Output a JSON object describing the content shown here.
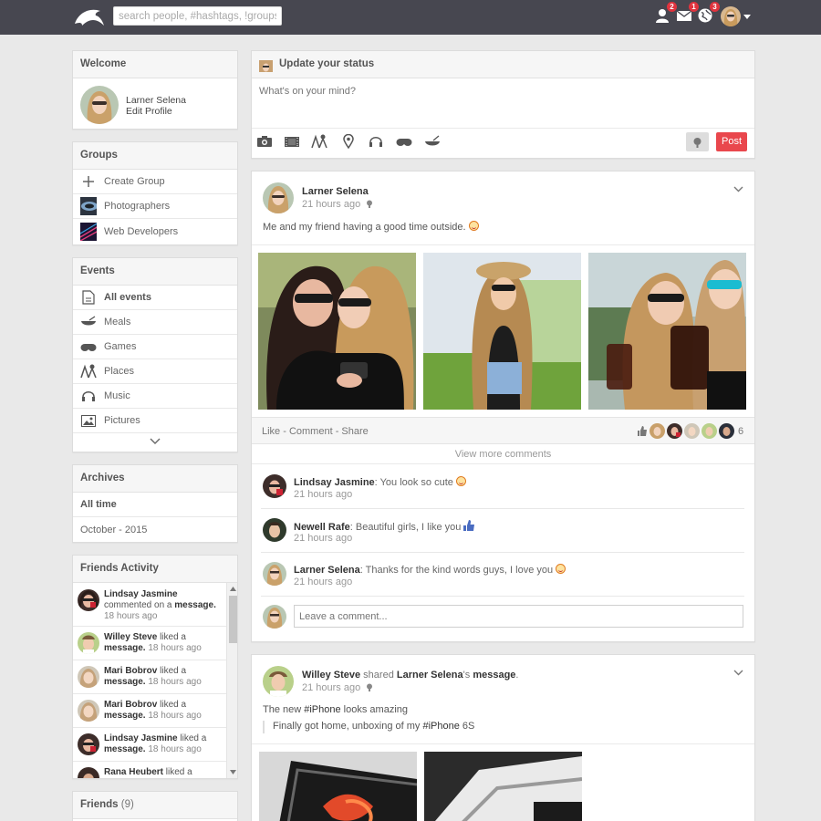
{
  "topbar": {
    "search_placeholder": "search people, #hashtags, !groups",
    "badges": {
      "friends": "2",
      "messages": "1",
      "notifications": "3"
    }
  },
  "welcome": {
    "title": "Welcome",
    "name": "Larner Selena",
    "edit": "Edit Profile"
  },
  "groups": {
    "title": "Groups",
    "items": [
      "Create Group",
      "Photographers",
      "Web Developers"
    ]
  },
  "events": {
    "title": "Events",
    "items": [
      "All events",
      "Meals",
      "Games",
      "Places",
      "Music",
      "Pictures"
    ]
  },
  "archives": {
    "title": "Archives",
    "items": [
      "All time",
      "October - 2015"
    ]
  },
  "friends_activity": {
    "title": "Friends Activity",
    "items": [
      {
        "name": "Lindsay Jasmine",
        "action": "commented on a",
        "object": "message.",
        "time": "18 hours ago"
      },
      {
        "name": "Willey Steve",
        "action": "liked a",
        "object": "message.",
        "time": "18 hours ago"
      },
      {
        "name": "Mari Bobrov",
        "action": "liked a",
        "object": "message.",
        "time": "18 hours ago"
      },
      {
        "name": "Mari Bobrov",
        "action": "liked a",
        "object": "message.",
        "time": "18 hours ago"
      },
      {
        "name": "Lindsay Jasmine",
        "action": "liked a",
        "object": "message.",
        "time": "18 hours ago"
      },
      {
        "name": "Rana Heubert",
        "action": "liked a",
        "object": "",
        "time": ""
      }
    ]
  },
  "friends": {
    "title": "Friends",
    "count": "(9)"
  },
  "status": {
    "title": "Update your status",
    "placeholder": "What's on your mind?",
    "post_label": "Post"
  },
  "post1": {
    "author": "Larner Selena",
    "time": "21 hours ago",
    "text": "Me and my friend having a good time outside.",
    "actions": "Like - Comment - Share",
    "likes_count": "6",
    "view_more": "View more comments",
    "comments": [
      {
        "name": "Lindsay Jasmine",
        "text": ": You look so cute",
        "time": "21 hours ago"
      },
      {
        "name": "Newell Rafe",
        "text": ": Beautiful girls, I like you",
        "time": "21 hours ago"
      },
      {
        "name": "Larner Selena",
        "text": ": Thanks for the kind words guys, I love you",
        "time": "21 hours ago"
      }
    ],
    "comment_placeholder": "Leave a comment..."
  },
  "post2": {
    "author": "Willey Steve",
    "verb": "shared",
    "target": "Larner Selena",
    "possessive": "'s",
    "object": "message",
    "time": "21 hours ago",
    "text_pre": "The new ",
    "hashtag": "#iPhone",
    "text_post": " looks amazing",
    "quote_pre": "Finally got home, unboxing of my ",
    "quote_hashtag": "#iPhone",
    "quote_post": " 6S"
  },
  "colors": {
    "topbar": "#474750",
    "accent": "#e9474d",
    "badge": "#e0333e"
  }
}
